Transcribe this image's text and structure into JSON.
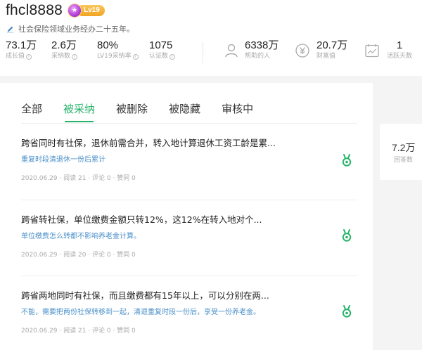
{
  "profile": {
    "username": "fhcl8888",
    "level_badge": "Lv19",
    "bio": "社会保险领域业务经办二十五年。",
    "stats": [
      {
        "value": "73.1万",
        "label": "成长值",
        "has_info": true
      },
      {
        "value": "2.6万",
        "label": "采纳数",
        "has_info": true
      },
      {
        "value": "80%",
        "label": "LV19采纳率",
        "has_info": true
      },
      {
        "value": "1075",
        "label": "认证数",
        "has_info": true
      }
    ],
    "icon_stats": [
      {
        "icon": "person-icon",
        "value": "6338万",
        "label": "帮助的人"
      },
      {
        "icon": "yen-coin-icon",
        "value": "20.7万",
        "label": "财富值"
      },
      {
        "icon": "calendar-chart-icon",
        "value": "1",
        "label": "活跃天数"
      }
    ]
  },
  "tabs": [
    {
      "label": "全部",
      "active": false
    },
    {
      "label": "被采纳",
      "active": true
    },
    {
      "label": "被删除",
      "active": false
    },
    {
      "label": "被隐藏",
      "active": false
    },
    {
      "label": "审核中",
      "active": false
    }
  ],
  "questions": [
    {
      "title": "跨省同时有社保，退休前需合并，转入地计算退休工资工龄是累...",
      "answer": "重复时段清退休一份后累计",
      "meta": "2020.06.29 · 阅读 21 · 评论 0 · 赞同 0"
    },
    {
      "title": "跨省转社保，单位缴费金额只转12%，这12%在转入地对个...",
      "answer": "单位缴费怎么转都不影响养老金计算。",
      "meta": "2020.06.29 · 阅读 20 · 评论 0 · 赞同 0"
    },
    {
      "title": "跨省两地同时有社保，而且缴费都有15年以上，可以分别在两...",
      "answer": "不能，需要把两份社保转移到一起，清退重复时段一份后，享受一份养老金。",
      "meta": "2020.06.29 · 阅读 21 · 评论 0 · 赞同 0"
    }
  ],
  "side_card": {
    "value": "7.2万",
    "label": "回答数"
  },
  "colors": {
    "accent": "#26b36a",
    "link": "#4a8fc8",
    "badge": "#f0a420"
  }
}
